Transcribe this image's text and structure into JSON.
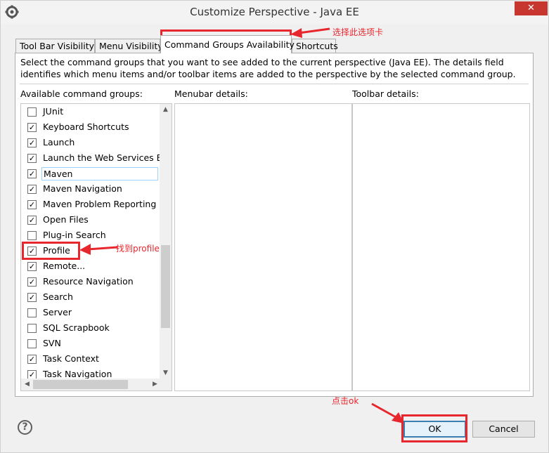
{
  "window": {
    "title": "Customize Perspective - Java EE",
    "close_glyph": "✕"
  },
  "tabs": [
    {
      "label": "Tool Bar Visibility",
      "active": false
    },
    {
      "label": "Menu Visibility",
      "active": false
    },
    {
      "label": "Command Groups Availability",
      "active": true
    },
    {
      "label": "Shortcuts",
      "active": false
    }
  ],
  "description": "Select the command groups that you want to see added to the current perspective (Java EE).  The details field identifies which menu items and/or toolbar items are added to the perspective by the selected command group.",
  "labels": {
    "available": "Available command groups:",
    "menubar": "Menubar details:",
    "toolbar": "Toolbar details:"
  },
  "command_groups": [
    {
      "label": "JUnit",
      "checked": false
    },
    {
      "label": "Keyboard Shortcuts",
      "checked": true
    },
    {
      "label": "Launch",
      "checked": true
    },
    {
      "label": "Launch the Web Services Exp",
      "checked": true
    },
    {
      "label": "Maven",
      "checked": true,
      "selected": true
    },
    {
      "label": "Maven Navigation",
      "checked": true
    },
    {
      "label": "Maven Problem Reporting",
      "checked": true
    },
    {
      "label": "Open Files",
      "checked": true
    },
    {
      "label": "Plug-in Search",
      "checked": false
    },
    {
      "label": "Profile",
      "checked": true
    },
    {
      "label": "Remote...",
      "checked": true
    },
    {
      "label": "Resource Navigation",
      "checked": true
    },
    {
      "label": "Search",
      "checked": true
    },
    {
      "label": "Server",
      "checked": false
    },
    {
      "label": "SQL Scrapbook",
      "checked": false
    },
    {
      "label": "SVN",
      "checked": false
    },
    {
      "label": "Task Context",
      "checked": true
    },
    {
      "label": "Task Navigation",
      "checked": true
    }
  ],
  "buttons": {
    "help": "?",
    "ok": "OK",
    "cancel": "Cancel"
  },
  "annotations": {
    "tab_note": "选择此选项卡",
    "profile_note": "找到profile",
    "ok_note": "点击ok"
  },
  "colors": {
    "annotation": "#e8262d",
    "close_button": "#c7372f"
  }
}
